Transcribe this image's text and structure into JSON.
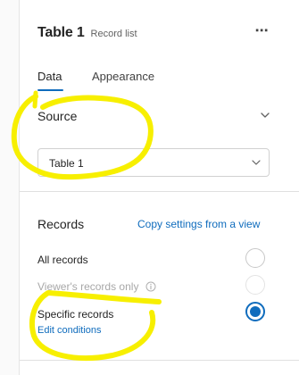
{
  "header": {
    "title": "Table 1",
    "subtitle": "Record list",
    "more_label": "⋯"
  },
  "tabs": [
    {
      "label": "Data",
      "active": true
    },
    {
      "label": "Appearance",
      "active": false
    }
  ],
  "source": {
    "heading": "Source",
    "selected_value": "Table 1"
  },
  "records": {
    "heading": "Records",
    "copy_link": "Copy settings from a view",
    "options": [
      {
        "label": "All records",
        "selected": false,
        "disabled": false
      },
      {
        "label": "Viewer's records only",
        "selected": false,
        "disabled": true,
        "info_icon": "info-icon"
      },
      {
        "label": "Specific records",
        "selected": true,
        "disabled": false,
        "sub_link": "Edit conditions"
      }
    ]
  },
  "colors": {
    "accent": "#0f6cbd",
    "highlighter": "#f7ef00"
  }
}
